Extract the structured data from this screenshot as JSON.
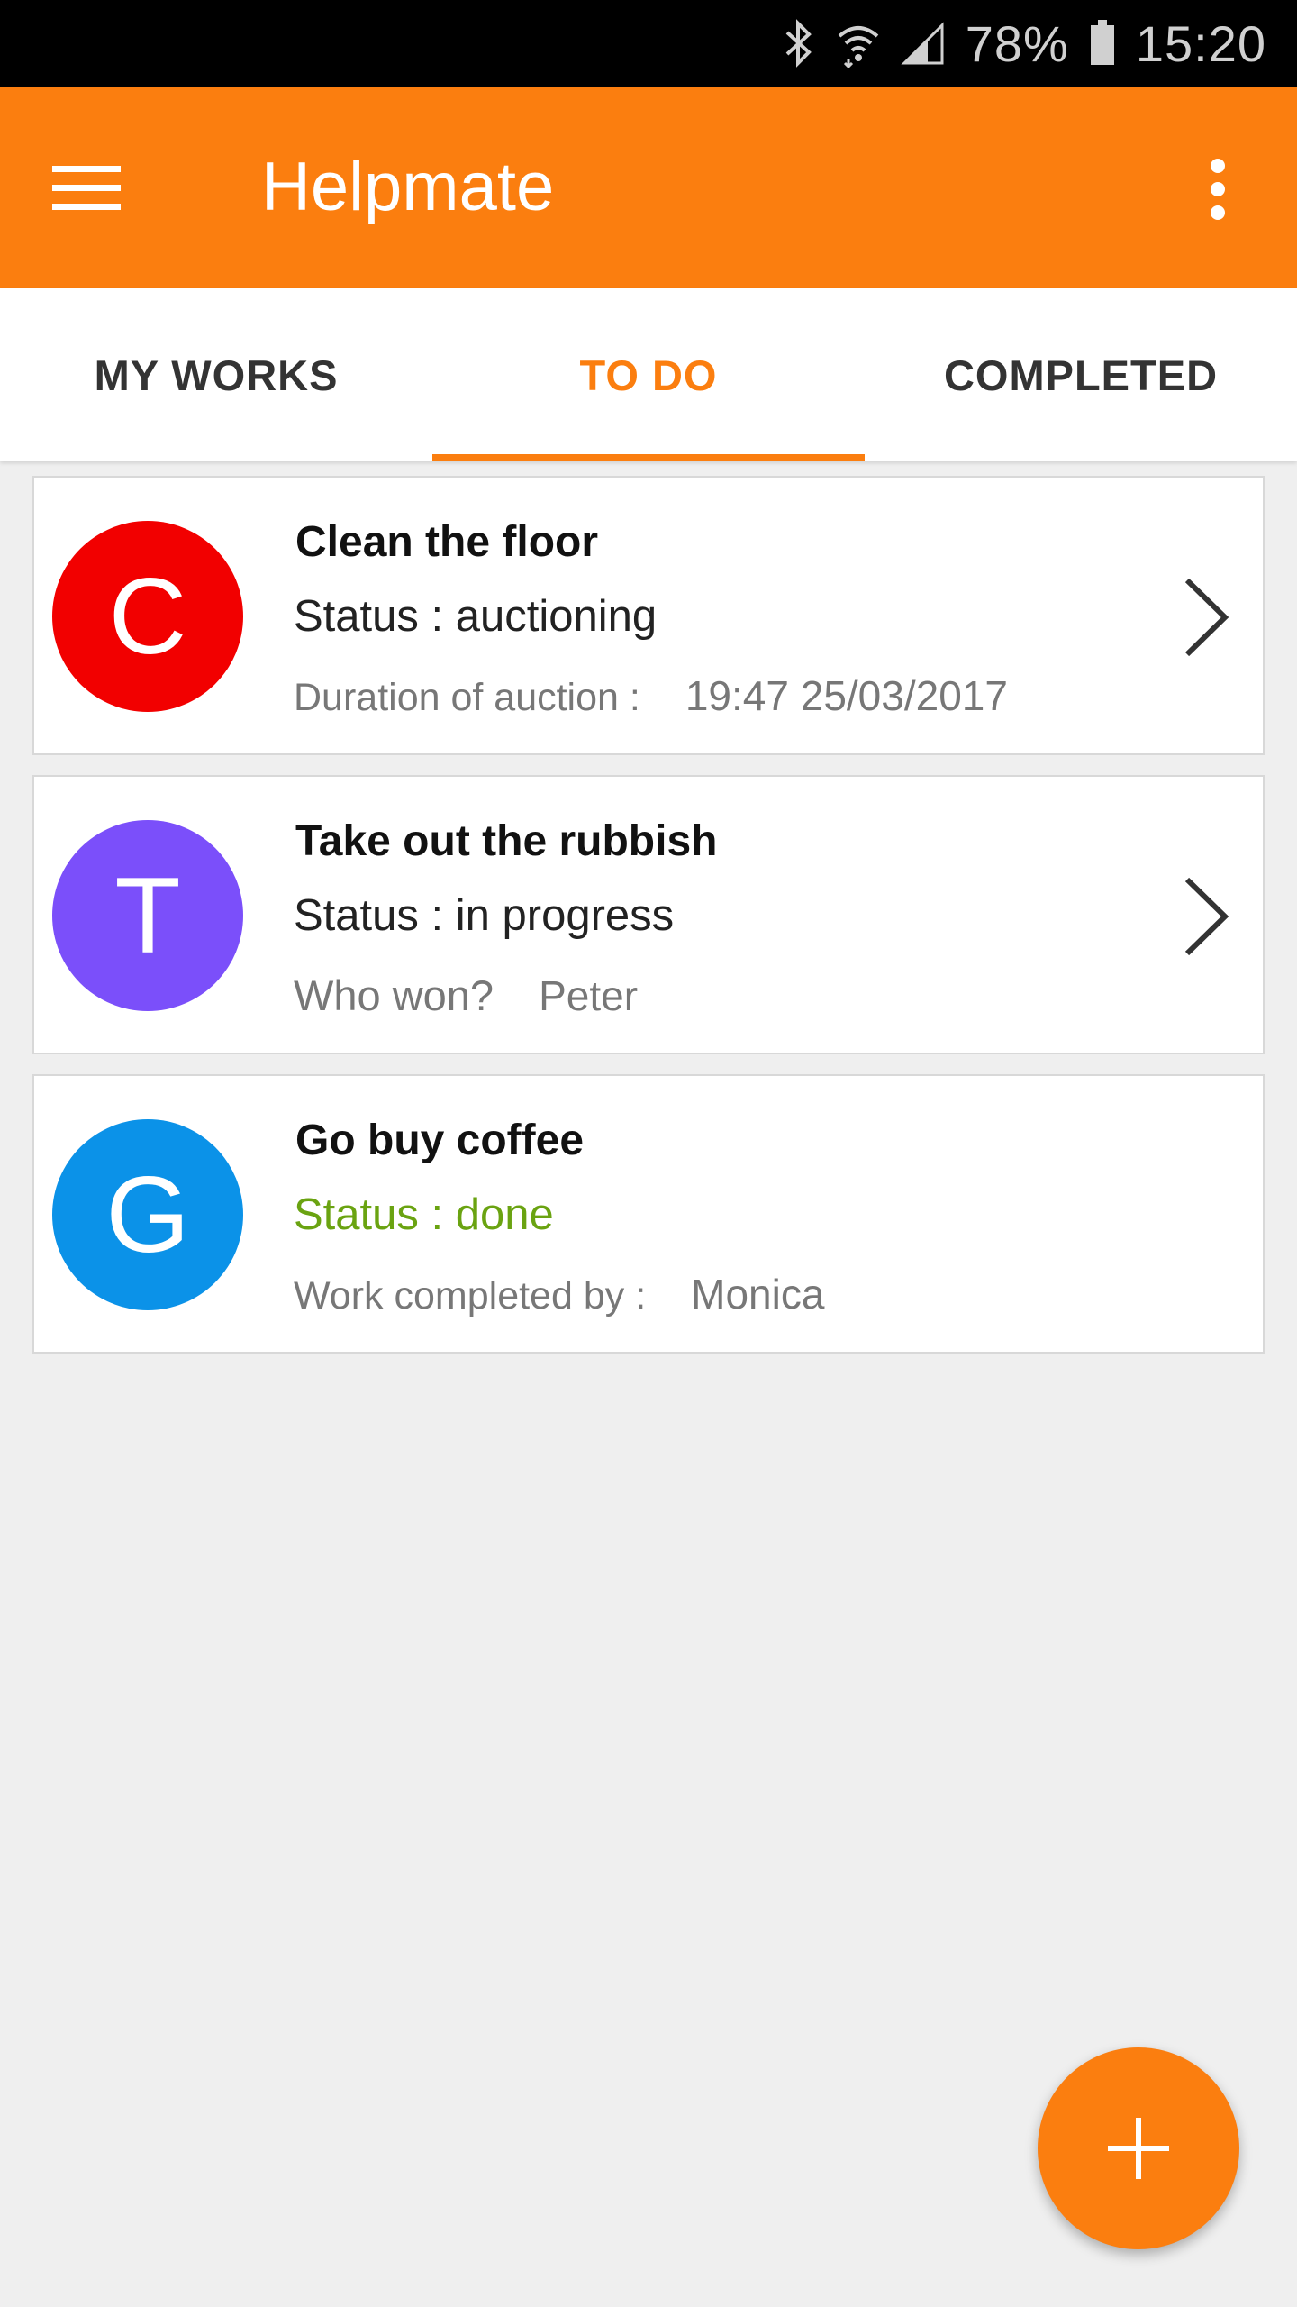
{
  "status_bar": {
    "battery": "78%",
    "time": "15:20",
    "icons": [
      "bluetooth-icon",
      "wifi-icon",
      "signal-icon",
      "battery-icon"
    ]
  },
  "app_bar": {
    "title": "Helpmate",
    "menu_icon": "menu-icon",
    "more_icon": "more-vertical-icon",
    "color": "#fb7e0f"
  },
  "tabs": [
    {
      "label": "MY WORKS",
      "active": false
    },
    {
      "label": "TO DO",
      "active": true
    },
    {
      "label": "COMPLETED",
      "active": false
    }
  ],
  "tasks": [
    {
      "initial": "C",
      "avatar_color": "#f20000",
      "title": "Clean the floor",
      "status": "Status : auctioning",
      "detail_label": "Duration of auction :",
      "detail_value": "19:47 25/03/2017",
      "has_chevron": true
    },
    {
      "initial": "T",
      "avatar_color": "#7b4ffa",
      "title": "Take out the rubbish",
      "status": "Status : in progress",
      "detail_label": "Who won?",
      "detail_value": "Peter",
      "has_chevron": true
    },
    {
      "initial": "G",
      "avatar_color": "#0b92e8",
      "title": "Go buy coffee",
      "status": "Status : done",
      "status_color": "#6aa311",
      "detail_label": "Work completed by :",
      "detail_value": "Monica",
      "has_chevron": false
    }
  ],
  "fab": {
    "icon": "plus-icon"
  }
}
